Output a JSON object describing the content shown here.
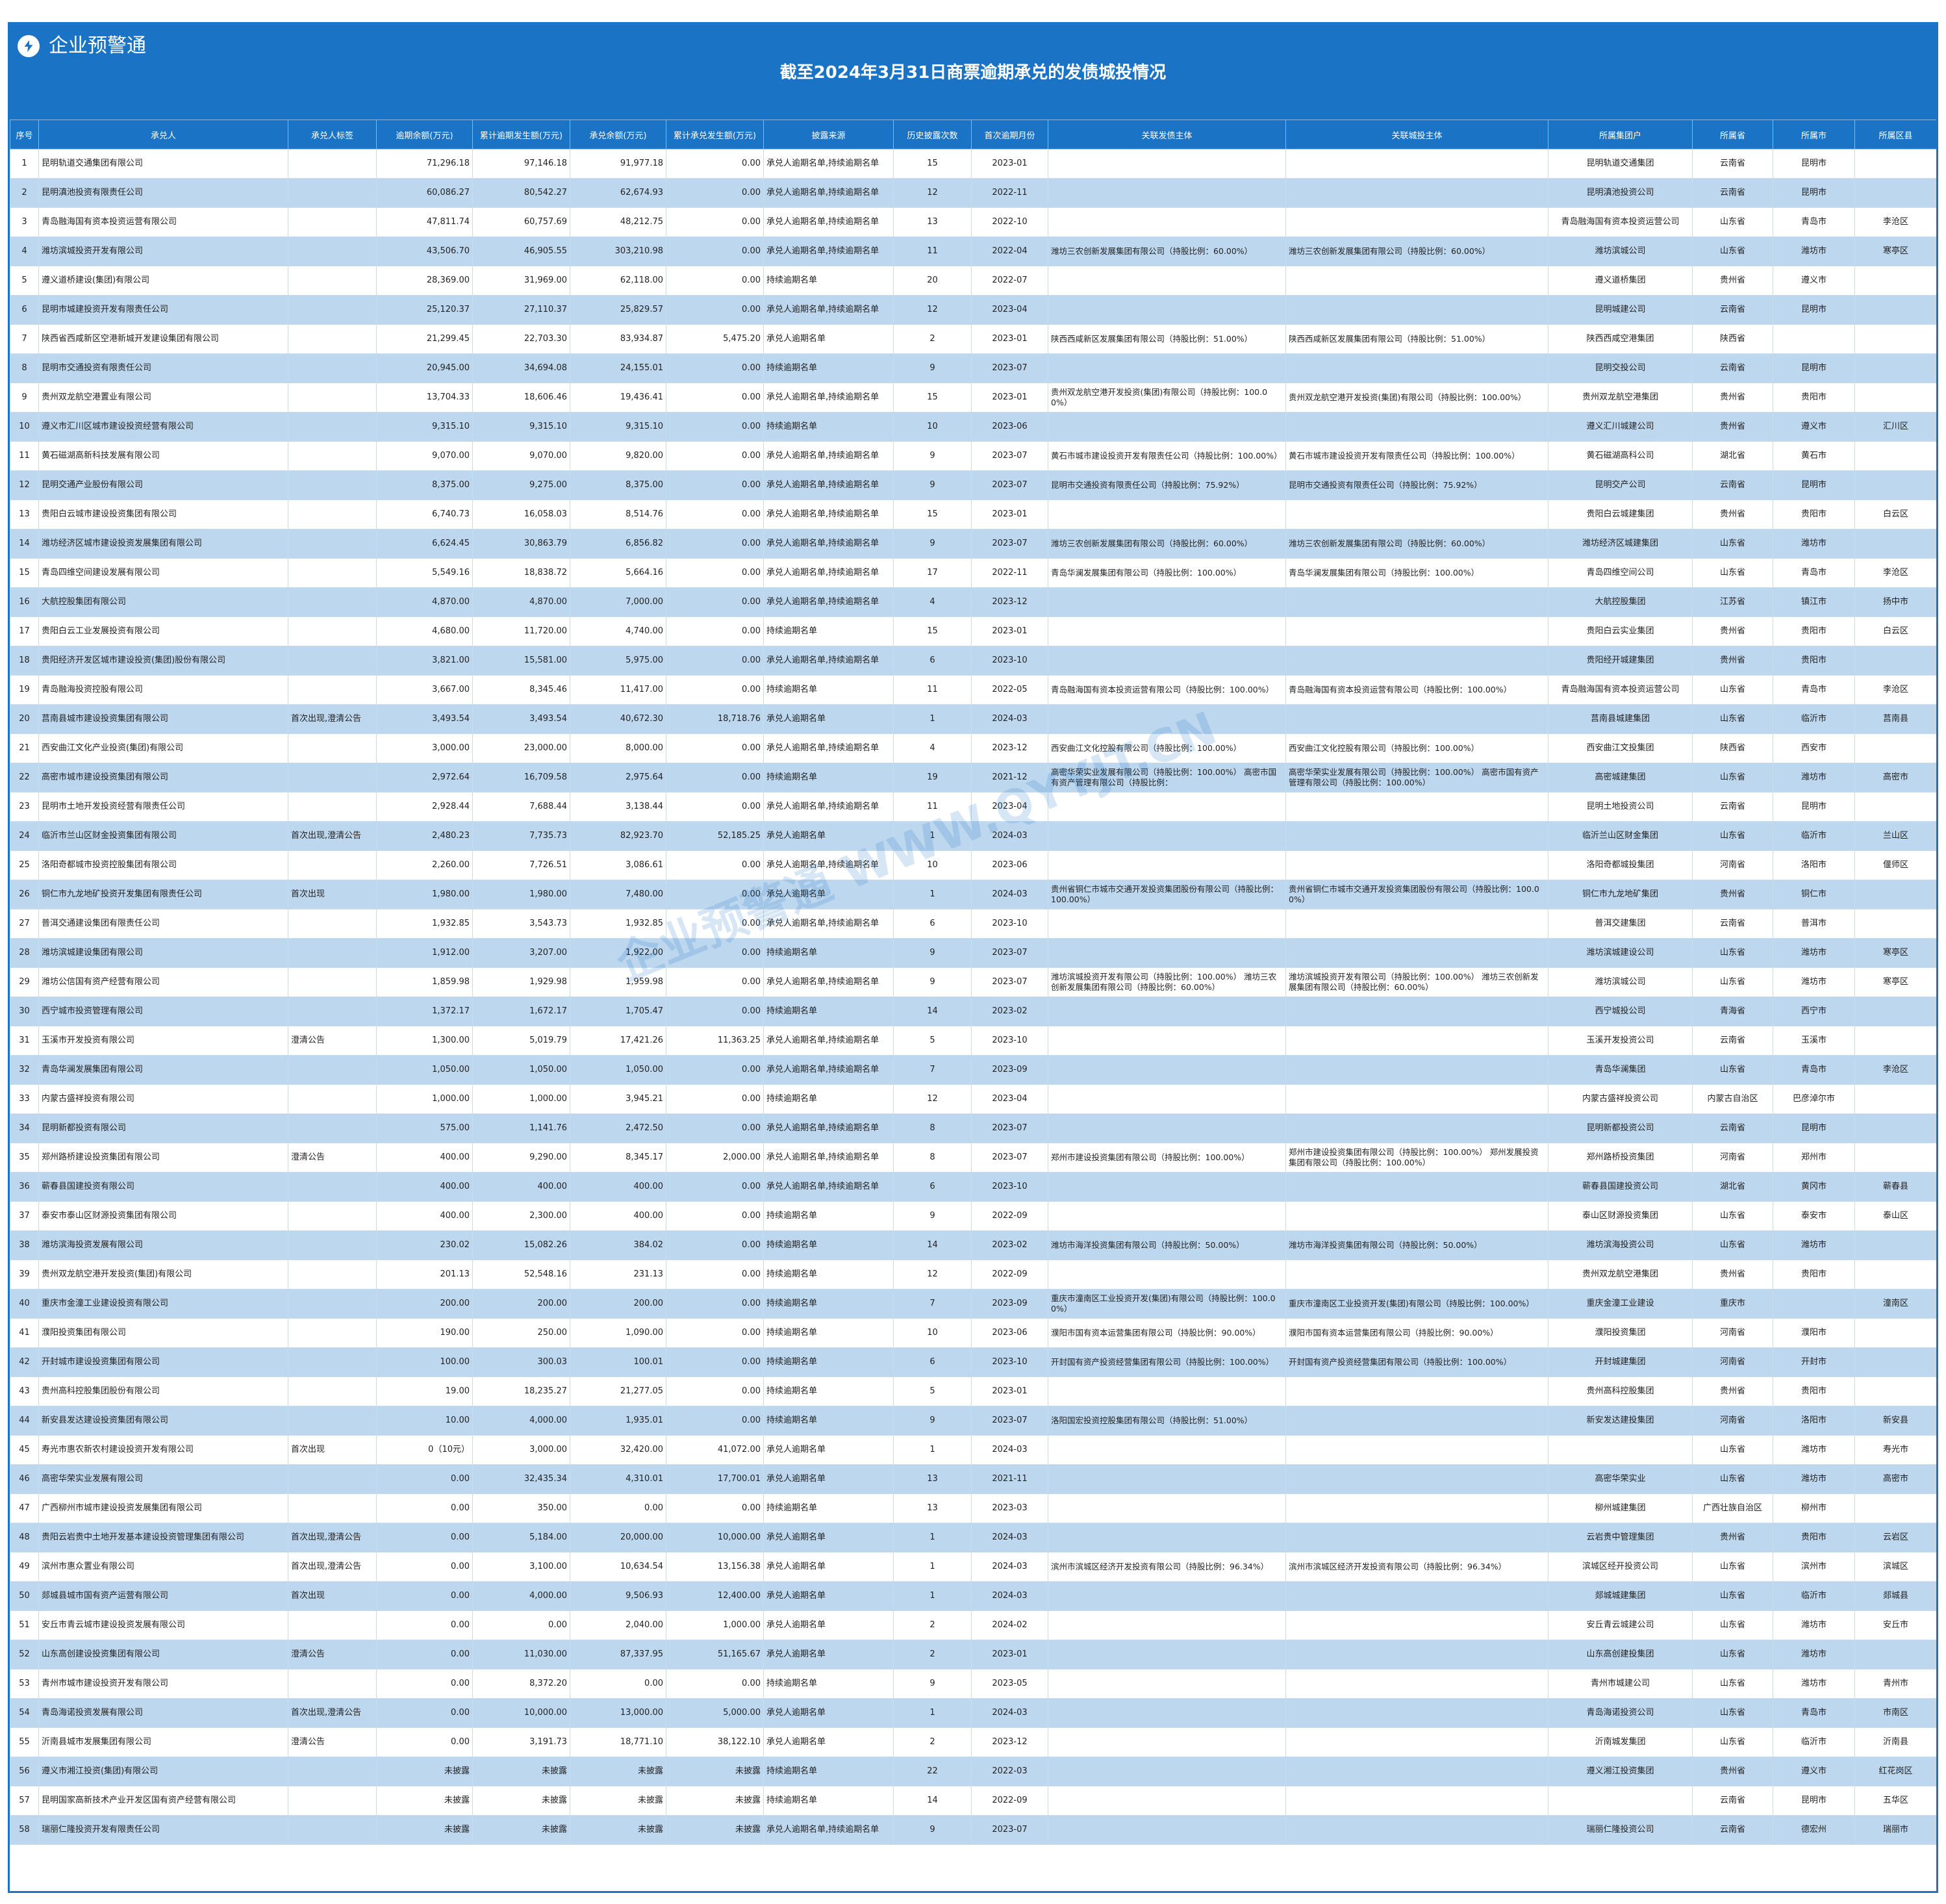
{
  "app": {
    "brand": "企业预警通",
    "brand_icon": "lightning-icon",
    "title": "截至2024年3月31日商票逾期承兑的发债城投情况",
    "watermark": "企业预警通 WWW.QYYJT.CN",
    "accent_color": "#1a73c4",
    "stripe_color": "#bdd7ee"
  },
  "columns": [
    "序号",
    "承兑人",
    "承兑人标签",
    "逾期余额(万元)",
    "累计逾期发生额(万元)",
    "承兑余额(万元)",
    "累计承兑发生额(万元)",
    "披露来源",
    "历史披露次数",
    "首次逾期月份",
    "关联发债主体",
    "关联城投主体",
    "所属集团户",
    "所属省",
    "所属市",
    "所属区县"
  ],
  "rows": [
    [
      "1",
      "昆明轨道交通集团有限公司",
      "",
      "71,296.18",
      "97,146.18",
      "91,977.18",
      "0.00",
      "承兑人逾期名单,持续逾期名单",
      "15",
      "2023-01",
      "",
      "",
      "昆明轨道交通集团",
      "云南省",
      "昆明市",
      ""
    ],
    [
      "2",
      "昆明滇池投资有限责任公司",
      "",
      "60,086.27",
      "80,542.27",
      "62,674.93",
      "0.00",
      "承兑人逾期名单,持续逾期名单",
      "12",
      "2022-11",
      "",
      "",
      "昆明滇池投资公司",
      "云南省",
      "昆明市",
      ""
    ],
    [
      "3",
      "青岛融海国有资本投资运营有限公司",
      "",
      "47,811.74",
      "60,757.69",
      "48,212.75",
      "0.00",
      "承兑人逾期名单,持续逾期名单",
      "13",
      "2022-10",
      "",
      "",
      "青岛融海国有资本投资运营公司",
      "山东省",
      "青岛市",
      "李沧区"
    ],
    [
      "4",
      "潍坊滨城投资开发有限公司",
      "",
      "43,506.70",
      "46,905.55",
      "303,210.98",
      "0.00",
      "承兑人逾期名单,持续逾期名单",
      "11",
      "2022-04",
      "潍坊三农创新发展集团有限公司（持股比例：60.00%）",
      "潍坊三农创新发展集团有限公司（持股比例：60.00%）",
      "潍坊滨城公司",
      "山东省",
      "潍坊市",
      "寒亭区"
    ],
    [
      "5",
      "遵义道桥建设(集团)有限公司",
      "",
      "28,369.00",
      "31,969.00",
      "62,118.00",
      "0.00",
      "持续逾期名单",
      "20",
      "2022-07",
      "",
      "",
      "遵义道桥集团",
      "贵州省",
      "遵义市",
      ""
    ],
    [
      "6",
      "昆明市城建投资开发有限责任公司",
      "",
      "25,120.37",
      "27,110.37",
      "25,829.57",
      "0.00",
      "承兑人逾期名单,持续逾期名单",
      "12",
      "2023-04",
      "",
      "",
      "昆明城建公司",
      "云南省",
      "昆明市",
      ""
    ],
    [
      "7",
      "陕西省西咸新区空港新城开发建设集团有限公司",
      "",
      "21,299.45",
      "22,703.30",
      "83,934.87",
      "5,475.20",
      "承兑人逾期名单",
      "2",
      "2023-01",
      "陕西西咸新区发展集团有限公司（持股比例：51.00%）",
      "陕西西咸新区发展集团有限公司（持股比例：51.00%）",
      "陕西西咸空港集团",
      "陕西省",
      "",
      ""
    ],
    [
      "8",
      "昆明市交通投资有限责任公司",
      "",
      "20,945.00",
      "34,694.08",
      "24,155.01",
      "0.00",
      "持续逾期名单",
      "9",
      "2023-07",
      "",
      "",
      "昆明交投公司",
      "云南省",
      "昆明市",
      ""
    ],
    [
      "9",
      "贵州双龙航空港置业有限公司",
      "",
      "13,704.33",
      "18,606.46",
      "19,436.41",
      "0.00",
      "承兑人逾期名单,持续逾期名单",
      "15",
      "2023-01",
      "贵州双龙航空港开发投资(集团)有限公司（持股比例：100.00%）",
      "贵州双龙航空港开发投资(集团)有限公司（持股比例：100.00%）",
      "贵州双龙航空港集团",
      "贵州省",
      "贵阳市",
      ""
    ],
    [
      "10",
      "遵义市汇川区城市建设投资经营有限公司",
      "",
      "9,315.10",
      "9,315.10",
      "9,315.10",
      "0.00",
      "持续逾期名单",
      "10",
      "2023-06",
      "",
      "",
      "遵义汇川城建公司",
      "贵州省",
      "遵义市",
      "汇川区"
    ],
    [
      "11",
      "黄石磁湖高新科技发展有限公司",
      "",
      "9,070.00",
      "9,070.00",
      "9,820.00",
      "0.00",
      "承兑人逾期名单,持续逾期名单",
      "9",
      "2023-07",
      "黄石市城市建设投资开发有限责任公司（持股比例：100.00%）",
      "黄石市城市建设投资开发有限责任公司（持股比例：100.00%）",
      "黄石磁湖高科公司",
      "湖北省",
      "黄石市",
      ""
    ],
    [
      "12",
      "昆明交通产业股份有限公司",
      "",
      "8,375.00",
      "9,275.00",
      "8,375.00",
      "0.00",
      "承兑人逾期名单,持续逾期名单",
      "9",
      "2023-07",
      "昆明市交通投资有限责任公司（持股比例：75.92%）",
      "昆明市交通投资有限责任公司（持股比例：75.92%）",
      "昆明交产公司",
      "云南省",
      "昆明市",
      ""
    ],
    [
      "13",
      "贵阳白云城市建设投资集团有限公司",
      "",
      "6,740.73",
      "16,058.03",
      "8,514.76",
      "0.00",
      "承兑人逾期名单,持续逾期名单",
      "15",
      "2023-01",
      "",
      "",
      "贵阳白云城建集团",
      "贵州省",
      "贵阳市",
      "白云区"
    ],
    [
      "14",
      "潍坊经济区城市建设投资发展集团有限公司",
      "",
      "6,624.45",
      "30,863.79",
      "6,856.82",
      "0.00",
      "承兑人逾期名单,持续逾期名单",
      "9",
      "2023-07",
      "潍坊三农创新发展集团有限公司（持股比例：60.00%）",
      "潍坊三农创新发展集团有限公司（持股比例：60.00%）",
      "潍坊经济区城建集团",
      "山东省",
      "潍坊市",
      ""
    ],
    [
      "15",
      "青岛四维空间建设发展有限公司",
      "",
      "5,549.16",
      "18,838.72",
      "5,664.16",
      "0.00",
      "承兑人逾期名单,持续逾期名单",
      "17",
      "2022-11",
      "青岛华澜发展集团有限公司（持股比例：100.00%）",
      "青岛华澜发展集团有限公司（持股比例：100.00%）",
      "青岛四维空间公司",
      "山东省",
      "青岛市",
      "李沧区"
    ],
    [
      "16",
      "大航控股集团有限公司",
      "",
      "4,870.00",
      "4,870.00",
      "7,000.00",
      "0.00",
      "承兑人逾期名单,持续逾期名单",
      "4",
      "2023-12",
      "",
      "",
      "大航控股集团",
      "江苏省",
      "镇江市",
      "扬中市"
    ],
    [
      "17",
      "贵阳白云工业发展投资有限公司",
      "",
      "4,680.00",
      "11,720.00",
      "4,740.00",
      "0.00",
      "持续逾期名单",
      "15",
      "2023-01",
      "",
      "",
      "贵阳白云实业集团",
      "贵州省",
      "贵阳市",
      "白云区"
    ],
    [
      "18",
      "贵阳经济开发区城市建设投资(集团)股份有限公司",
      "",
      "3,821.00",
      "15,581.00",
      "5,975.00",
      "0.00",
      "承兑人逾期名单,持续逾期名单",
      "6",
      "2023-10",
      "",
      "",
      "贵阳经开城建集团",
      "贵州省",
      "贵阳市",
      ""
    ],
    [
      "19",
      "青岛融海投资控股有限公司",
      "",
      "3,667.00",
      "8,345.46",
      "11,417.00",
      "0.00",
      "持续逾期名单",
      "11",
      "2022-05",
      "青岛融海国有资本投资运营有限公司（持股比例：100.00%）",
      "青岛融海国有资本投资运营有限公司（持股比例：100.00%）",
      "青岛融海国有资本投资运营公司",
      "山东省",
      "青岛市",
      "李沧区"
    ],
    [
      "20",
      "莒南县城市建设投资集团有限公司",
      "首次出现,澄清公告",
      "3,493.54",
      "3,493.54",
      "40,672.30",
      "18,718.76",
      "承兑人逾期名单",
      "1",
      "2024-03",
      "",
      "",
      "莒南县城建集团",
      "山东省",
      "临沂市",
      "莒南县"
    ],
    [
      "21",
      "西安曲江文化产业投资(集团)有限公司",
      "",
      "3,000.00",
      "23,000.00",
      "8,000.00",
      "0.00",
      "承兑人逾期名单,持续逾期名单",
      "4",
      "2023-12",
      "西安曲江文化控股有限公司（持股比例：100.00%）",
      "西安曲江文化控股有限公司（持股比例：100.00%）",
      "西安曲江文投集团",
      "陕西省",
      "西安市",
      ""
    ],
    [
      "22",
      "高密市城市建设投资集团有限公司",
      "",
      "2,972.64",
      "16,709.58",
      "2,975.64",
      "0.00",
      "持续逾期名单",
      "19",
      "2021-12",
      "高密华荣实业发展有限公司（持股比例：100.00%） 高密市国有资产管理有限公司（持股比例：",
      "高密华荣实业发展有限公司（持股比例：100.00%） 高密市国有资产管理有限公司（持股比例：100.00%）",
      "高密城建集团",
      "山东省",
      "潍坊市",
      "高密市"
    ],
    [
      "23",
      "昆明市土地开发投资经营有限责任公司",
      "",
      "2,928.44",
      "7,688.44",
      "3,138.44",
      "0.00",
      "承兑人逾期名单,持续逾期名单",
      "11",
      "2023-04",
      "",
      "",
      "昆明土地投资公司",
      "云南省",
      "昆明市",
      ""
    ],
    [
      "24",
      "临沂市兰山区财金投资集团有限公司",
      "首次出现,澄清公告",
      "2,480.23",
      "7,735.73",
      "82,923.70",
      "52,185.25",
      "承兑人逾期名单",
      "1",
      "2024-03",
      "",
      "",
      "临沂兰山区财金集团",
      "山东省",
      "临沂市",
      "兰山区"
    ],
    [
      "25",
      "洛阳奇都城市投资控股集团有限公司",
      "",
      "2,260.00",
      "7,726.51",
      "3,086.61",
      "0.00",
      "承兑人逾期名单,持续逾期名单",
      "10",
      "2023-06",
      "",
      "",
      "洛阳奇都城投集团",
      "河南省",
      "洛阳市",
      "偃师区"
    ],
    [
      "26",
      "铜仁市九龙地矿投资开发集团有限责任公司",
      "首次出现",
      "1,980.00",
      "1,980.00",
      "7,480.00",
      "0.00",
      "承兑人逾期名单",
      "1",
      "2024-03",
      "贵州省铜仁市城市交通开发投资集团股份有限公司（持股比例：100.00%）",
      "贵州省铜仁市城市交通开发投资集团股份有限公司（持股比例：100.00%）",
      "铜仁市九龙地矿集团",
      "贵州省",
      "铜仁市",
      ""
    ],
    [
      "27",
      "普洱交通建设集团有限责任公司",
      "",
      "1,932.85",
      "3,543.73",
      "1,932.85",
      "0.00",
      "承兑人逾期名单,持续逾期名单",
      "6",
      "2023-10",
      "",
      "",
      "普洱交建集团",
      "云南省",
      "普洱市",
      ""
    ],
    [
      "28",
      "潍坊滨城建设集团有限公司",
      "",
      "1,912.00",
      "3,207.00",
      "1,922.00",
      "0.00",
      "持续逾期名单",
      "9",
      "2023-07",
      "",
      "",
      "潍坊滨城建设公司",
      "山东省",
      "潍坊市",
      "寒亭区"
    ],
    [
      "29",
      "潍坊公信国有资产经营有限公司",
      "",
      "1,859.98",
      "1,929.98",
      "1,959.98",
      "0.00",
      "承兑人逾期名单,持续逾期名单",
      "9",
      "2023-07",
      "潍坊滨城投资开发有限公司（持股比例：100.00%） 潍坊三农创新发展集团有限公司（持股比例：60.00%）",
      "潍坊滨城投资开发有限公司（持股比例：100.00%） 潍坊三农创新发展集团有限公司（持股比例：60.00%）",
      "潍坊滨城公司",
      "山东省",
      "潍坊市",
      "寒亭区"
    ],
    [
      "30",
      "西宁城市投资管理有限公司",
      "",
      "1,372.17",
      "1,672.17",
      "1,705.47",
      "0.00",
      "持续逾期名单",
      "14",
      "2023-02",
      "",
      "",
      "西宁城投公司",
      "青海省",
      "西宁市",
      ""
    ],
    [
      "31",
      "玉溪市开发投资有限公司",
      "澄清公告",
      "1,300.00",
      "5,019.79",
      "17,421.26",
      "11,363.25",
      "承兑人逾期名单,持续逾期名单",
      "5",
      "2023-10",
      "",
      "",
      "玉溪开发投资公司",
      "云南省",
      "玉溪市",
      ""
    ],
    [
      "32",
      "青岛华澜发展集团有限公司",
      "",
      "1,050.00",
      "1,050.00",
      "1,050.00",
      "0.00",
      "承兑人逾期名单,持续逾期名单",
      "7",
      "2023-09",
      "",
      "",
      "青岛华澜集团",
      "山东省",
      "青岛市",
      "李沧区"
    ],
    [
      "33",
      "内蒙古盛祥投资有限公司",
      "",
      "1,000.00",
      "1,000.00",
      "3,945.21",
      "0.00",
      "持续逾期名单",
      "12",
      "2023-04",
      "",
      "",
      "内蒙古盛祥投资公司",
      "内蒙古自治区",
      "巴彦淖尔市",
      ""
    ],
    [
      "34",
      "昆明新都投资有限公司",
      "",
      "575.00",
      "1,141.76",
      "2,472.50",
      "0.00",
      "承兑人逾期名单,持续逾期名单",
      "8",
      "2023-07",
      "",
      "",
      "昆明新都投资公司",
      "云南省",
      "昆明市",
      ""
    ],
    [
      "35",
      "郑州路桥建设投资集团有限公司",
      "澄清公告",
      "400.00",
      "9,290.00",
      "8,345.17",
      "2,000.00",
      "承兑人逾期名单,持续逾期名单",
      "8",
      "2023-07",
      "郑州市建设投资集团有限公司（持股比例：100.00%）",
      "郑州市建设投资集团有限公司（持股比例：100.00%） 郑州发展投资集团有限公司（持股比例：100.00%）",
      "郑州路桥投资集团",
      "河南省",
      "郑州市",
      ""
    ],
    [
      "36",
      "蕲春县国建投资有限公司",
      "",
      "400.00",
      "400.00",
      "400.00",
      "0.00",
      "承兑人逾期名单,持续逾期名单",
      "6",
      "2023-10",
      "",
      "",
      "蕲春县国建投资公司",
      "湖北省",
      "黄冈市",
      "蕲春县"
    ],
    [
      "37",
      "泰安市泰山区财源投资集团有限公司",
      "",
      "400.00",
      "2,300.00",
      "400.00",
      "0.00",
      "持续逾期名单",
      "9",
      "2022-09",
      "",
      "",
      "泰山区财源投资集团",
      "山东省",
      "泰安市",
      "泰山区"
    ],
    [
      "38",
      "潍坊滨海投资发展有限公司",
      "",
      "230.02",
      "15,082.26",
      "384.02",
      "0.00",
      "持续逾期名单",
      "14",
      "2023-02",
      "潍坊市海洋投资集团有限公司（持股比例：50.00%）",
      "潍坊市海洋投资集团有限公司（持股比例：50.00%）",
      "潍坊滨海投资公司",
      "山东省",
      "潍坊市",
      ""
    ],
    [
      "39",
      "贵州双龙航空港开发投资(集团)有限公司",
      "",
      "201.13",
      "52,548.16",
      "231.13",
      "0.00",
      "持续逾期名单",
      "12",
      "2022-09",
      "",
      "",
      "贵州双龙航空港集团",
      "贵州省",
      "贵阳市",
      ""
    ],
    [
      "40",
      "重庆市金潼工业建设投资有限公司",
      "",
      "200.00",
      "200.00",
      "200.00",
      "0.00",
      "持续逾期名单",
      "7",
      "2023-09",
      "重庆市潼南区工业投资开发(集团)有限公司（持股比例：100.00%）",
      "重庆市潼南区工业投资开发(集团)有限公司（持股比例：100.00%）",
      "重庆金潼工业建设",
      "重庆市",
      "",
      "潼南区"
    ],
    [
      "41",
      "濮阳投资集团有限公司",
      "",
      "190.00",
      "250.00",
      "1,090.00",
      "0.00",
      "持续逾期名单",
      "10",
      "2023-06",
      "濮阳市国有资本运营集团有限公司（持股比例：90.00%）",
      "濮阳市国有资本运营集团有限公司（持股比例：90.00%）",
      "濮阳投资集团",
      "河南省",
      "濮阳市",
      ""
    ],
    [
      "42",
      "开封城市建设投资集团有限公司",
      "",
      "100.00",
      "300.03",
      "100.01",
      "0.00",
      "持续逾期名单",
      "6",
      "2023-10",
      "开封国有资产投资经营集团有限公司（持股比例：100.00%）",
      "开封国有资产投资经营集团有限公司（持股比例：100.00%）",
      "开封城建集团",
      "河南省",
      "开封市",
      ""
    ],
    [
      "43",
      "贵州高科控股集团股份有限公司",
      "",
      "19.00",
      "18,235.27",
      "21,277.05",
      "0.00",
      "持续逾期名单",
      "5",
      "2023-01",
      "",
      "",
      "贵州高科控股集团",
      "贵州省",
      "贵阳市",
      ""
    ],
    [
      "44",
      "新安县发达建设投资集团有限公司",
      "",
      "10.00",
      "4,000.00",
      "1,935.01",
      "0.00",
      "持续逾期名单",
      "9",
      "2023-07",
      "洛阳国宏投资控股集团有限公司（持股比例：51.00%）",
      "",
      "新安发达建投集团",
      "河南省",
      "洛阳市",
      "新安县"
    ],
    [
      "45",
      "寿光市惠农新农村建设投资开发有限公司",
      "首次出现",
      "0（10元）",
      "3,000.00",
      "32,420.00",
      "41,072.00",
      "承兑人逾期名单",
      "1",
      "2024-03",
      "",
      "",
      "",
      "山东省",
      "潍坊市",
      "寿光市"
    ],
    [
      "46",
      "高密华荣实业发展有限公司",
      "",
      "0.00",
      "32,435.34",
      "4,310.01",
      "17,700.01",
      "承兑人逾期名单",
      "13",
      "2021-11",
      "",
      "",
      "高密华荣实业",
      "山东省",
      "潍坊市",
      "高密市"
    ],
    [
      "47",
      "广西柳州市城市建设投资发展集团有限公司",
      "",
      "0.00",
      "350.00",
      "0.00",
      "0.00",
      "持续逾期名单",
      "13",
      "2023-03",
      "",
      "",
      "柳州城建集团",
      "广西壮族自治区",
      "柳州市",
      ""
    ],
    [
      "48",
      "贵阳云岩贵中土地开发基本建设投资管理集团有限公司",
      "首次出现,澄清公告",
      "0.00",
      "5,184.00",
      "20,000.00",
      "10,000.00",
      "承兑人逾期名单",
      "1",
      "2024-03",
      "",
      "",
      "云岩贵中管理集团",
      "贵州省",
      "贵阳市",
      "云岩区"
    ],
    [
      "49",
      "滨州市惠众置业有限公司",
      "首次出现,澄清公告",
      "0.00",
      "3,100.00",
      "10,634.54",
      "13,156.38",
      "承兑人逾期名单",
      "1",
      "2024-03",
      "滨州市滨城区经济开发投资有限公司（持股比例：96.34%）",
      "滨州市滨城区经济开发投资有限公司（持股比例：96.34%）",
      "滨城区经开投资公司",
      "山东省",
      "滨州市",
      "滨城区"
    ],
    [
      "50",
      "郯城县城市国有资产运营有限公司",
      "首次出现",
      "0.00",
      "4,000.00",
      "9,506.93",
      "12,400.00",
      "承兑人逾期名单",
      "1",
      "2024-03",
      "",
      "",
      "郯城城建集团",
      "山东省",
      "临沂市",
      "郯城县"
    ],
    [
      "51",
      "安丘市青云城市建设投资发展有限公司",
      "",
      "0.00",
      "0.00",
      "2,040.00",
      "1,000.00",
      "承兑人逾期名单",
      "2",
      "2024-02",
      "",
      "",
      "安丘青云城建公司",
      "山东省",
      "潍坊市",
      "安丘市"
    ],
    [
      "52",
      "山东高创建设投资集团有限公司",
      "澄清公告",
      "0.00",
      "11,030.00",
      "87,337.95",
      "51,165.67",
      "承兑人逾期名单",
      "2",
      "2023-01",
      "",
      "",
      "山东高创建投集团",
      "山东省",
      "潍坊市",
      ""
    ],
    [
      "53",
      "青州市城市建设投资开发有限公司",
      "",
      "0.00",
      "8,372.20",
      "0.00",
      "0.00",
      "持续逾期名单",
      "9",
      "2023-05",
      "",
      "",
      "青州市城建公司",
      "山东省",
      "潍坊市",
      "青州市"
    ],
    [
      "54",
      "青岛海诺投资发展有限公司",
      "首次出现,澄清公告",
      "0.00",
      "10,000.00",
      "13,000.00",
      "5,000.00",
      "承兑人逾期名单",
      "1",
      "2024-03",
      "",
      "",
      "青岛海诺投资公司",
      "山东省",
      "青岛市",
      "市南区"
    ],
    [
      "55",
      "沂南县城市发展集团有限公司",
      "澄清公告",
      "0.00",
      "3,191.73",
      "18,771.10",
      "38,122.10",
      "承兑人逾期名单",
      "2",
      "2023-12",
      "",
      "",
      "沂南城发集团",
      "山东省",
      "临沂市",
      "沂南县"
    ],
    [
      "56",
      "遵义市湘江投资(集团)有限公司",
      "",
      "未披露",
      "未披露",
      "未披露",
      "未披露",
      "持续逾期名单",
      "22",
      "2022-03",
      "",
      "",
      "遵义湘江投资集团",
      "贵州省",
      "遵义市",
      "红花岗区"
    ],
    [
      "57",
      "昆明国家高新技术产业开发区国有资产经营有限公司",
      "",
      "未披露",
      "未披露",
      "未披露",
      "未披露",
      "持续逾期名单",
      "14",
      "2022-09",
      "",
      "",
      "",
      "云南省",
      "昆明市",
      "五华区"
    ],
    [
      "58",
      "瑞丽仁隆投资开发有限责任公司",
      "",
      "未披露",
      "未披露",
      "未披露",
      "未披露",
      "承兑人逾期名单,持续逾期名单",
      "9",
      "2023-07",
      "",
      "",
      "瑞丽仁隆投资公司",
      "云南省",
      "德宏州",
      "瑞丽市"
    ]
  ]
}
